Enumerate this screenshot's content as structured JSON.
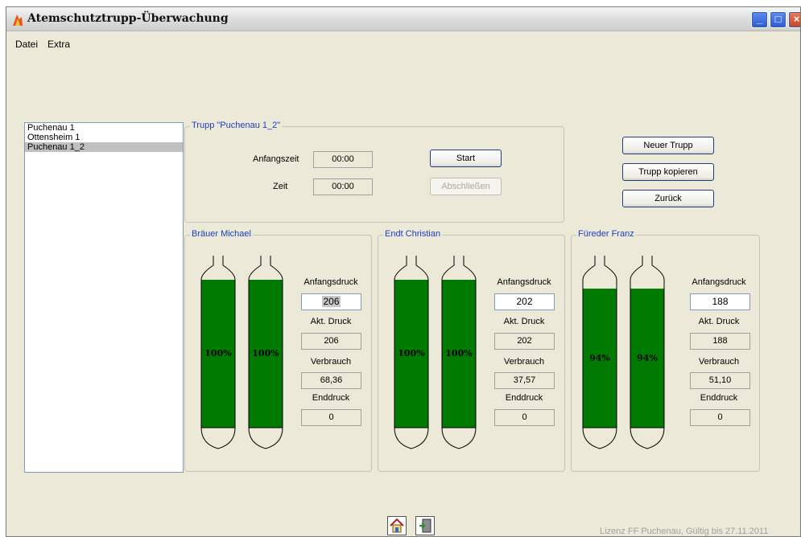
{
  "window": {
    "title": "Atemschutztrupp-Überwachung"
  },
  "menu": {
    "items": [
      "Datei",
      "Extra"
    ]
  },
  "trupp_list": {
    "items": [
      "Puchenau 1",
      "Ottensheim 1",
      "Puchenau 1_2"
    ],
    "selected_index": 2
  },
  "trupp_group": {
    "title": "Trupp \"Puchenau 1_2\"",
    "anfangszeit_label": "Anfangszeit",
    "anfangszeit_value": "00:00",
    "zeit_label": "Zeit",
    "zeit_value": "00:00",
    "start_label": "Start",
    "abschliessen_label": "Abschließen"
  },
  "actions": {
    "neuer_trupp": "Neuer Trupp",
    "trupp_kopieren": "Trupp kopieren",
    "zurueck": "Zurück"
  },
  "labels": {
    "anfangsdruck": "Anfangsdruck",
    "akt_druck": "Akt. Druck",
    "verbrauch": "Verbrauch",
    "enddruck": "Enddruck"
  },
  "members": [
    {
      "name": "Bräuer Michael",
      "percent_label": "100%",
      "fill_fraction": 1.0,
      "anfangsdruck": "206",
      "akt_druck": "206",
      "verbrauch": "68,36",
      "enddruck": "0"
    },
    {
      "name": "Endt Christian",
      "percent_label": "100%",
      "fill_fraction": 1.0,
      "anfangsdruck": "202",
      "akt_druck": "202",
      "verbrauch": "37,57",
      "enddruck": "0"
    },
    {
      "name": "Füreder Franz",
      "percent_label": "94%",
      "fill_fraction": 0.94,
      "anfangsdruck": "188",
      "akt_druck": "188",
      "verbrauch": "51,10",
      "enddruck": "0"
    }
  ],
  "colors": {
    "tank_fill": "#007a00",
    "legend_text": "#1a3fc4"
  },
  "status": {
    "license": "Lizenz FF Puchenau, Gültig bis 27.11.2011"
  },
  "icons": {
    "home": "home-icon",
    "exit": "exit-door-icon"
  }
}
